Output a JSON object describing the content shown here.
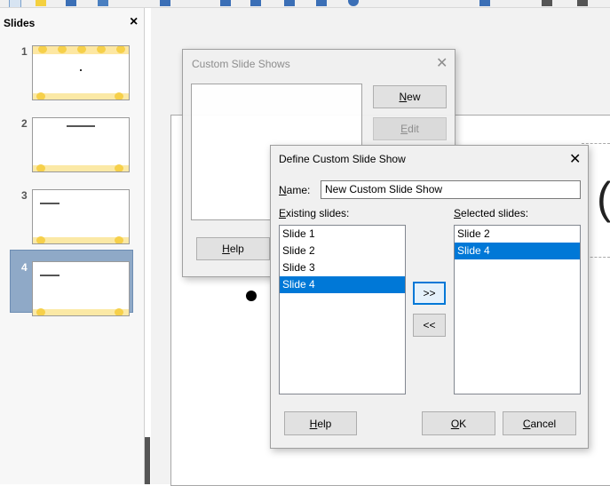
{
  "slides_pane": {
    "title": "Slides",
    "close_glyph": "×",
    "slides": [
      {
        "number": "1"
      },
      {
        "number": "2"
      },
      {
        "number": "3"
      },
      {
        "number": "4"
      }
    ],
    "selected_index": 4
  },
  "background_dialog": {
    "title": "Custom Slide Shows",
    "close_glyph": "✕",
    "new_label_first": "N",
    "new_label_rest": "ew",
    "edit_label_first": "E",
    "edit_label_rest": "dit",
    "help_label_first": "H",
    "help_label_rest": "elp"
  },
  "define_dialog": {
    "title": "Define Custom Slide Show",
    "close_glyph": "✕",
    "name_label_first": "N",
    "name_label_rest": "ame:",
    "name_value": "New Custom Slide Show",
    "existing_label_first": "E",
    "existing_label_rest": "xisting slides:",
    "selected_label_first": "S",
    "selected_label_rest": "elected slides:",
    "existing_slides": [
      "Slide 1",
      "Slide 2",
      "Slide 3",
      "Slide 4"
    ],
    "existing_selected": "Slide 4",
    "selected_slides": [
      "Slide 2",
      "Slide 4"
    ],
    "selected_selected": "Slide 4",
    "add_button": ">>",
    "remove_button": "<<",
    "help_first": "H",
    "help_rest": "elp",
    "ok_first": "O",
    "ok_rest": "K",
    "cancel_first": "C",
    "cancel_rest": "ancel"
  },
  "colors": {
    "selection": "#0078d7",
    "slide_selected_bg": "#8fa9c7",
    "honeycomb": "#f6d04a"
  }
}
